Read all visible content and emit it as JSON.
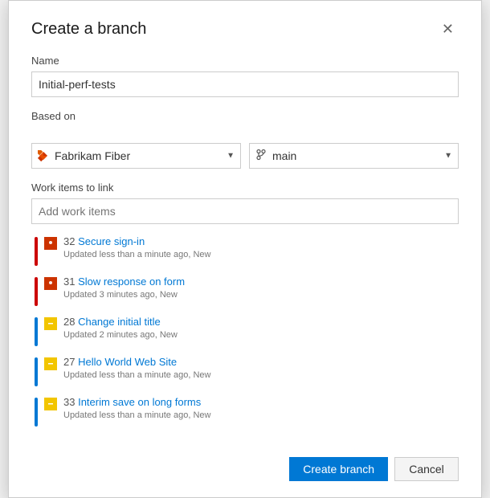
{
  "dialog": {
    "title": "Create a branch",
    "close_label": "✕"
  },
  "form": {
    "name_label": "Name",
    "name_value": "Initial-perf-tests",
    "based_on_label": "Based on",
    "repo_label": "Fabrikam Fiber",
    "repo_options": [
      "Fabrikam Fiber"
    ],
    "branch_label": "main",
    "branch_options": [
      "main"
    ],
    "work_items_label": "Work items to link",
    "add_work_items_placeholder": "Add work items"
  },
  "work_items": [
    {
      "id": "32",
      "title": "Secure sign-in",
      "subtitle": "Updated less than a minute ago, New",
      "priority": "red",
      "icon_type": "bug"
    },
    {
      "id": "31",
      "title": "Slow response on form",
      "subtitle": "Updated 3 minutes ago, New",
      "priority": "red",
      "icon_type": "bug"
    },
    {
      "id": "28",
      "title": "Change initial title",
      "subtitle": "Updated 2 minutes ago, New",
      "priority": "blue",
      "icon_type": "task"
    },
    {
      "id": "27",
      "title": "Hello World Web Site",
      "subtitle": "Updated less than a minute ago, New",
      "priority": "blue",
      "icon_type": "task"
    },
    {
      "id": "33",
      "title": "Interim save on long forms",
      "subtitle": "Updated less than a minute ago, New",
      "priority": "blue",
      "icon_type": "task"
    }
  ],
  "footer": {
    "create_label": "Create branch",
    "cancel_label": "Cancel"
  }
}
